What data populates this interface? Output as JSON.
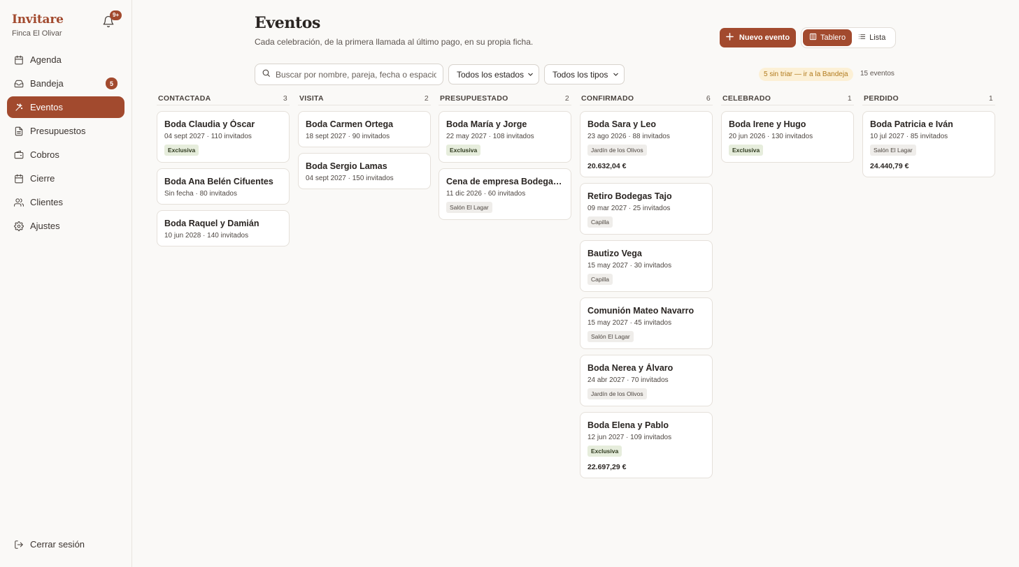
{
  "app": {
    "name": "Invitare",
    "venue": "Finca El Olivar",
    "notifications_badge": "9+"
  },
  "sidebar": {
    "items": [
      {
        "label": "Agenda",
        "icon": "calendar-icon",
        "active": false,
        "count": null
      },
      {
        "label": "Bandeja",
        "icon": "inbox-icon",
        "active": false,
        "count": "5"
      },
      {
        "label": "Eventos",
        "icon": "sparkle-icon",
        "active": true,
        "count": null
      },
      {
        "label": "Presupuestos",
        "icon": "document-icon",
        "active": false,
        "count": null
      },
      {
        "label": "Cobros",
        "icon": "wallet-icon",
        "active": false,
        "count": null
      },
      {
        "label": "Cierre",
        "icon": "calendar-check-icon",
        "active": false,
        "count": null
      },
      {
        "label": "Clientes",
        "icon": "users-icon",
        "active": false,
        "count": null
      },
      {
        "label": "Ajustes",
        "icon": "gear-icon",
        "active": false,
        "count": null
      }
    ],
    "logout_label": "Cerrar sesión"
  },
  "header": {
    "title": "Eventos",
    "subtitle": "Cada celebración, de la primera llamada al último pago, en su propia ficha.",
    "new_event_label": "Nuevo evento",
    "view_board_label": "Tablero",
    "view_list_label": "Lista",
    "active_view": "Tablero"
  },
  "filters": {
    "search_placeholder": "Buscar por nombre, pareja, fecha o espacio",
    "search_value": "",
    "status_select": "Todos los estados",
    "type_select": "Todos los tipos",
    "untriaged_notice": "5 sin triar — ir a la Bandeja",
    "events_count": "15 eventos"
  },
  "colors": {
    "accent": "#a24a2e",
    "background": "#faf9f7",
    "warning_bg": "#fcf0d6",
    "warning_text": "#b17a1c"
  },
  "board": {
    "columns": [
      {
        "name": "CONTACTADA",
        "count": "3",
        "cards": [
          {
            "title": "Boda Claudia y Óscar",
            "meta": "04 sept 2027 · 110 invitados",
            "tag": "Exclusiva",
            "tag_kind": "ex",
            "amount": ""
          },
          {
            "title": "Boda Ana Belén Cifuentes",
            "meta": "Sin fecha · 80 invitados",
            "tag": "",
            "tag_kind": "",
            "amount": ""
          },
          {
            "title": "Boda Raquel y Damián",
            "meta": "10 jun 2028 · 140 invitados",
            "tag": "",
            "tag_kind": "",
            "amount": ""
          }
        ]
      },
      {
        "name": "VISITA",
        "count": "2",
        "cards": [
          {
            "title": "Boda Carmen Ortega",
            "meta": "18 sept 2027 · 90 invitados",
            "tag": "",
            "tag_kind": "",
            "amount": ""
          },
          {
            "title": "Boda Sergio Lamas",
            "meta": "04 sept 2027 · 150 invitados",
            "tag": "",
            "tag_kind": "",
            "amount": ""
          }
        ]
      },
      {
        "name": "PRESUPUESTADO",
        "count": "2",
        "cards": [
          {
            "title": "Boda María y Jorge",
            "meta": "22 may 2027 · 108 invitados",
            "tag": "Exclusiva",
            "tag_kind": "ex",
            "amount": ""
          },
          {
            "title": "Cena de empresa Bodegas Tajo",
            "meta": "11 dic 2026 · 60 invitados",
            "tag": "Salón El Lagar",
            "tag_kind": "sp",
            "amount": ""
          }
        ]
      },
      {
        "name": "CONFIRMADO",
        "count": "6",
        "cards": [
          {
            "title": "Boda Sara y Leo",
            "meta": "23 ago 2026 · 88 invitados",
            "tag": "Jardín de los Olivos",
            "tag_kind": "sp",
            "amount": "20.632,04 €"
          },
          {
            "title": "Retiro Bodegas Tajo",
            "meta": "09 mar 2027 · 25 invitados",
            "tag": "Capilla",
            "tag_kind": "sp",
            "amount": ""
          },
          {
            "title": "Bautizo Vega",
            "meta": "15 may 2027 · 30 invitados",
            "tag": "Capilla",
            "tag_kind": "sp",
            "amount": ""
          },
          {
            "title": "Comunión Mateo Navarro",
            "meta": "15 may 2027 · 45 invitados",
            "tag": "Salón El Lagar",
            "tag_kind": "sp",
            "amount": ""
          },
          {
            "title": "Boda Nerea y Álvaro",
            "meta": "24 abr 2027 · 70 invitados",
            "tag": "Jardín de los Olivos",
            "tag_kind": "sp",
            "amount": ""
          },
          {
            "title": "Boda Elena y Pablo",
            "meta": "12 jun 2027 · 109 invitados",
            "tag": "Exclusiva",
            "tag_kind": "ex",
            "amount": "22.697,29 €"
          }
        ]
      },
      {
        "name": "CELEBRADO",
        "count": "1",
        "cards": [
          {
            "title": "Boda Irene y Hugo",
            "meta": "20 jun 2026 · 130 invitados",
            "tag": "Exclusiva",
            "tag_kind": "ex",
            "amount": ""
          }
        ]
      },
      {
        "name": "PERDIDO",
        "count": "1",
        "cards": [
          {
            "title": "Boda Patricia e Iván",
            "meta": "10 jul 2027 · 85 invitados",
            "tag": "Salón El Lagar",
            "tag_kind": "sp",
            "amount": "24.440,79 €"
          }
        ]
      }
    ]
  }
}
